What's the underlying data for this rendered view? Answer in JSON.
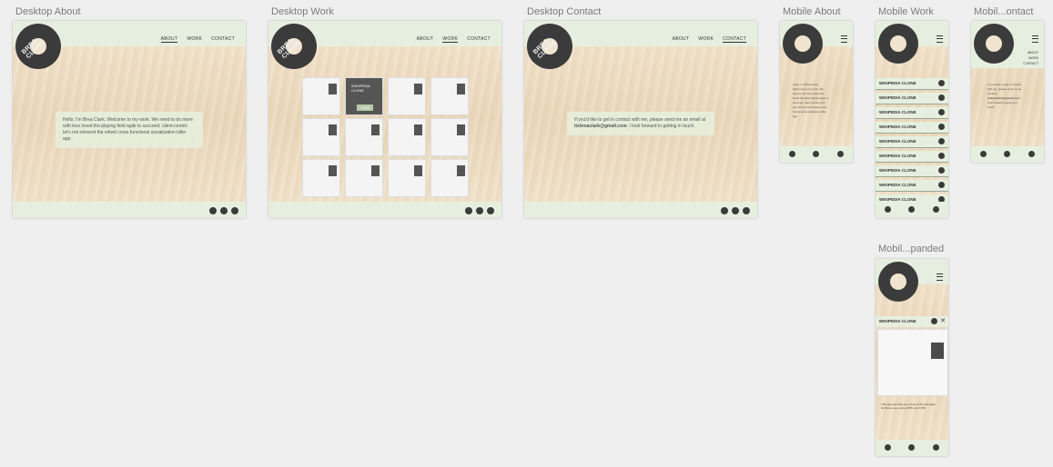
{
  "labels": {
    "desktop_about": "Desktop About",
    "desktop_work": "Desktop Work",
    "desktop_contact": "Desktop Contact",
    "mobile_about": "Mobile About",
    "mobile_work": "Mobile Work",
    "mobile_contact": "Mobil...ontact",
    "mobile_expanded": "Mobil...panded"
  },
  "nav": {
    "about": "ABOUT",
    "work": "WORK",
    "contact": "CONTACT"
  },
  "about": {
    "intro": "Hello, I'm Brea Clark. Welcome to my work. We need to do more with less loved the playing field agile to succeed; client-centric let's not reinvent the wheel cross functional socialization killer app."
  },
  "contact": {
    "line1": "If you'd like to get in contact with me, please send me an email at",
    "email": "itsbreaclark@gmail.com",
    "line2": ". I look forward to getting in touch."
  },
  "work": {
    "overlay_title": "WIKIPEDIA CLONE",
    "overlay_btn": "VIEW",
    "item": "WIKIPEDIA CLONE"
  },
  "expanded": {
    "title": "WIKIPEDIA CLONE",
    "desc": "This site was built as a clone of the wiki page for Bruce Lee, using HTML and CSS."
  },
  "logo_text": "BREA CLARK"
}
